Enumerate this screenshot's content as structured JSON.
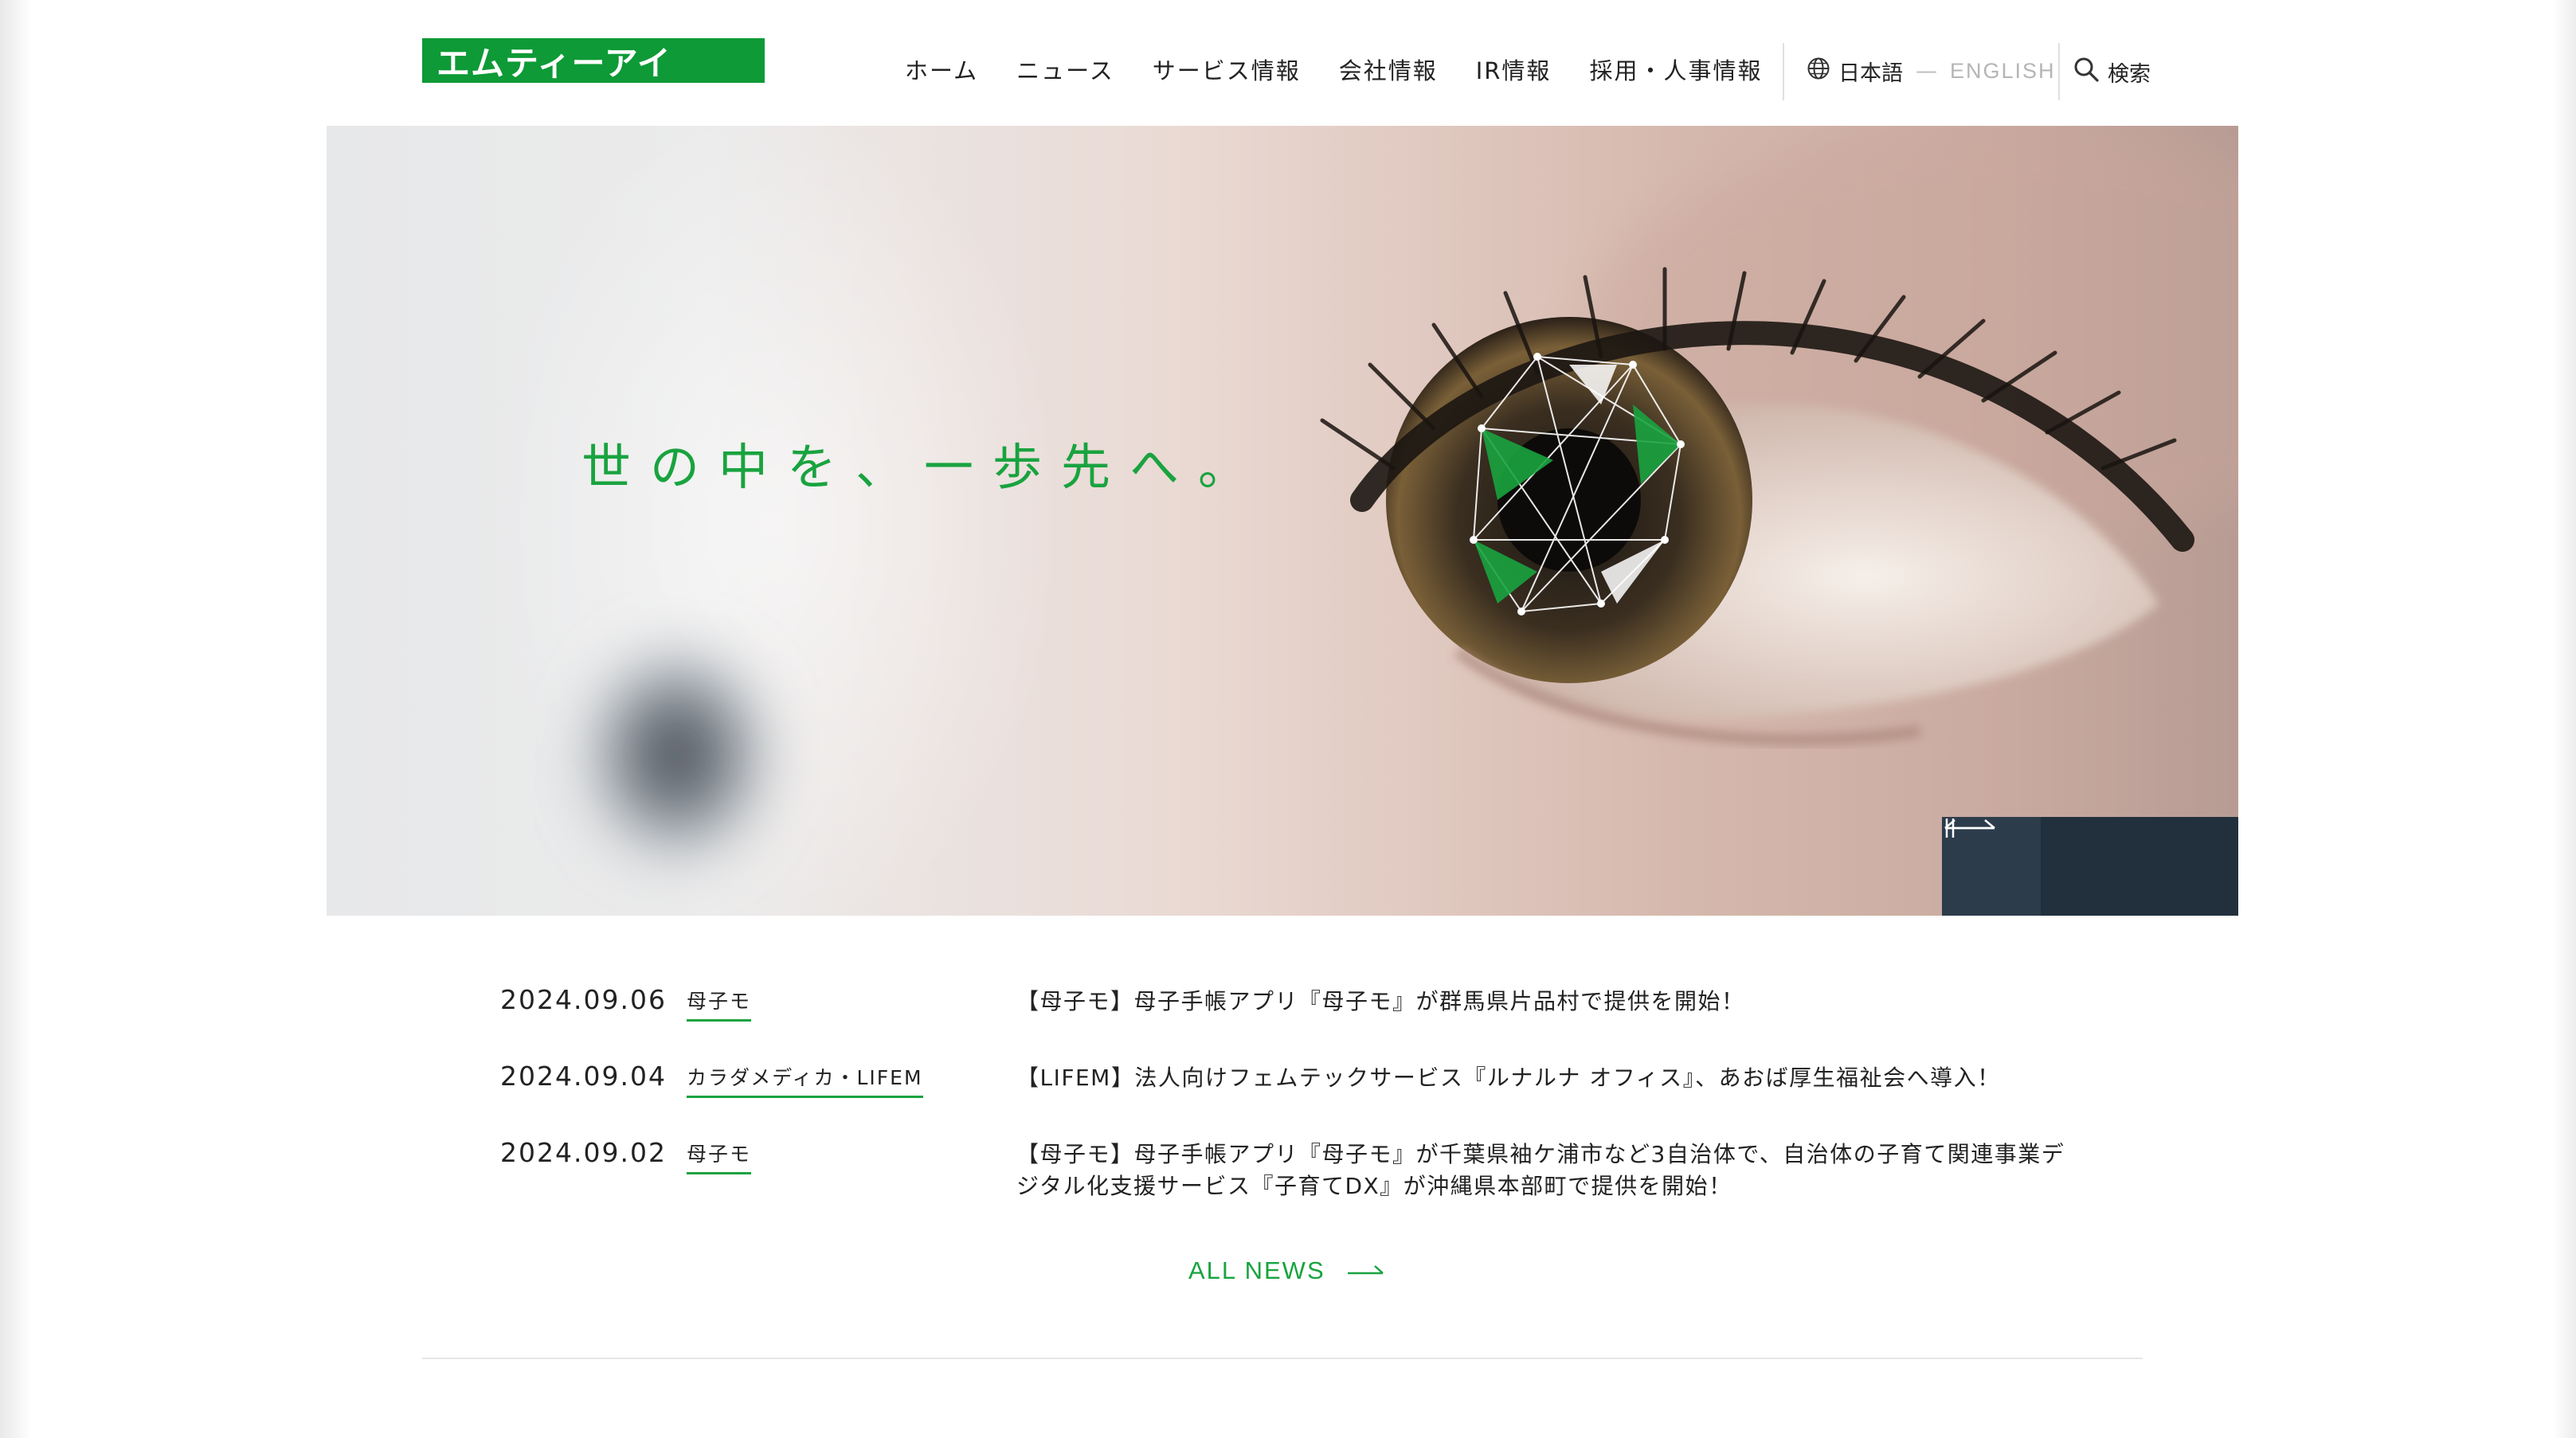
{
  "header": {
    "logo_text": "エムティーアイ",
    "nav": [
      "ホーム",
      "ニュース",
      "サービス情報",
      "会社情報",
      "IR情報",
      "採用・人事情報"
    ],
    "lang_ja": "日本語",
    "lang_separator": "—",
    "lang_en": "ENGLISH",
    "search_label": "検索"
  },
  "hero": {
    "tagline": "世の中を、一歩先へ。",
    "controls": {
      "pause_icon": "pause-icon",
      "prev_icon": "arrow-left-icon",
      "next_icon": "arrow-right-icon"
    }
  },
  "news": {
    "items": [
      {
        "date": "2024.09.06",
        "tag": "母子モ",
        "title": "【母子モ】母子手帳アプリ『母子モ』が群馬県片品村で提供を開始！"
      },
      {
        "date": "2024.09.04",
        "tag": "カラダメディカ・LIFEM",
        "title": "【LIFEM】法人向けフェムテックサービス『ルナルナ オフィス』、あおば厚生福祉会へ導入！"
      },
      {
        "date": "2024.09.02",
        "tag": "母子モ",
        "title": "【母子モ】母子手帳アプリ『母子モ』が千葉県袖ケ浦市など3自治体で、自治体の子育て関連事業デジタル化支援サービス『子育てDX』が沖縄県本部町で提供を開始！"
      }
    ],
    "all_news_label": "ALL NEWS"
  },
  "colors": {
    "brand_green": "#0e9a36",
    "tagline_green": "#19a33f",
    "control_dark": "#22303d"
  }
}
